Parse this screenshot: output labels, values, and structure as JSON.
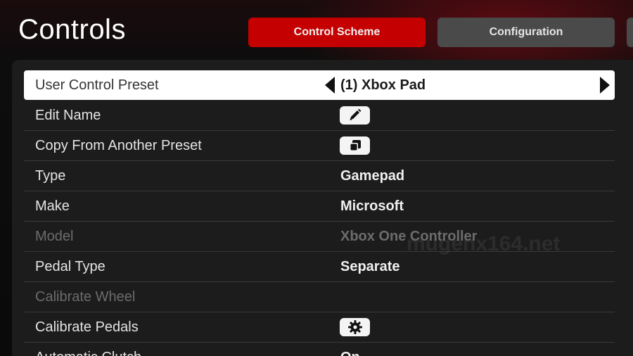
{
  "header": {
    "title": "Controls",
    "tabs": [
      {
        "label": "Control Scheme",
        "active": true
      },
      {
        "label": "Configuration",
        "active": false
      }
    ]
  },
  "colors": {
    "accent": "#c50000",
    "tab_inactive": "#4a4a4a",
    "panel": "#1c1c1c",
    "disabled_text": "#6c6c6c"
  },
  "rows": [
    {
      "label": "User Control Preset",
      "value": "(1) Xbox Pad",
      "kind": "selector",
      "selected": true
    },
    {
      "label": "Edit Name",
      "value": "",
      "kind": "button",
      "icon": "pencil-icon"
    },
    {
      "label": "Copy From Another Preset",
      "value": "",
      "kind": "button",
      "icon": "copy-icon"
    },
    {
      "label": "Type",
      "value": "Gamepad",
      "kind": "text"
    },
    {
      "label": "Make",
      "value": "Microsoft",
      "kind": "text"
    },
    {
      "label": "Model",
      "value": "Xbox One Controller",
      "kind": "text",
      "disabled": true
    },
    {
      "label": "Pedal Type",
      "value": "Separate",
      "kind": "text"
    },
    {
      "label": "Calibrate Wheel",
      "value": "",
      "kind": "text",
      "disabled": true
    },
    {
      "label": "Calibrate Pedals",
      "value": "",
      "kind": "button",
      "icon": "gear-icon"
    },
    {
      "label": "Automatic Clutch",
      "value": "On",
      "kind": "text"
    }
  ],
  "watermark": "mugenx164.net"
}
